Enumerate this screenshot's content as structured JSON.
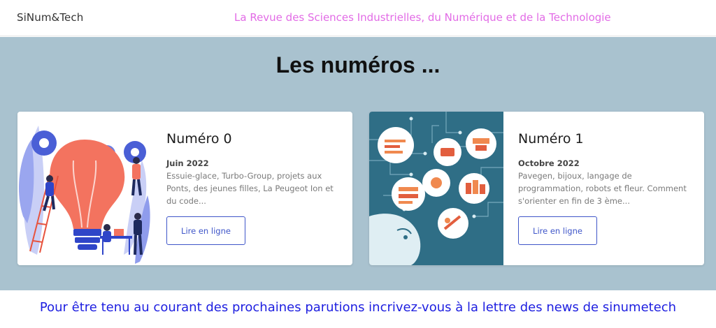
{
  "header": {
    "brand": "SiNum&Tech",
    "tagline": "La Revue des Sciences Industrielles, du Numérique et de la Technologie"
  },
  "section": {
    "title": "Les numéros ..."
  },
  "issues": [
    {
      "title": "Numéro 0",
      "date": "Juin 2022",
      "description": "Essuie-glace, Turbo-Group, projets aux Ponts, des jeunes filles, La Peugeot Ion et du code...",
      "button_label": "Lire en ligne",
      "illustration": "lightbulb-illustration"
    },
    {
      "title": "Numéro 1",
      "date": "Octobre 2022",
      "description": "Pavegen, bijoux, langage de programmation, robots et fleur. Comment s'orienter en fin de 3 ème...",
      "button_label": "Lire en ligne",
      "illustration": "brain-circuit-illustration"
    }
  ],
  "newsletter": {
    "text": "Pour être tenu au courant des prochaines parutions incrivez-vous à la lettre des news de sinumetech"
  },
  "colors": {
    "band_background": "#a9c2cf",
    "tagline": "#e26be6",
    "button_accent": "#3f56c9",
    "newsletter_text": "#1d1ee0"
  }
}
